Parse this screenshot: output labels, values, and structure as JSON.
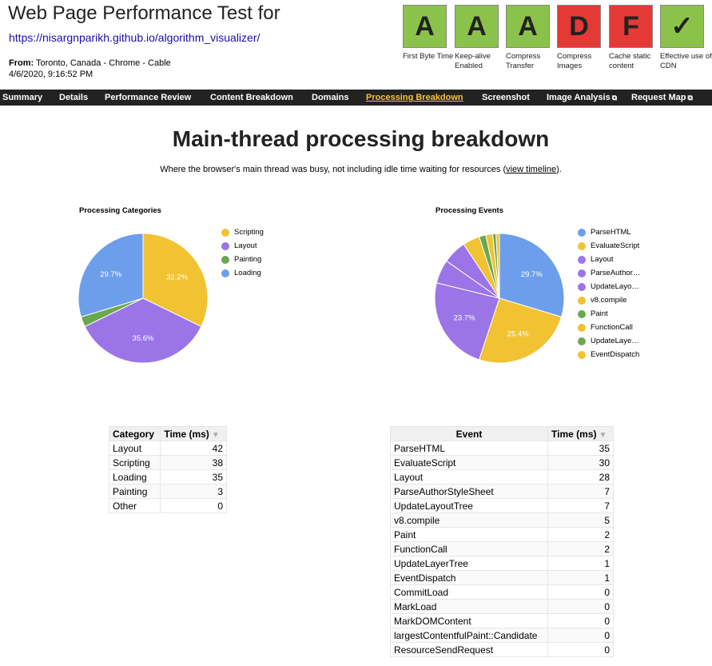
{
  "header": {
    "title": "Web Page Performance Test for",
    "url": "https://nisargnparikh.github.io/algorithm_visualizer/",
    "from_label": "From:",
    "from_value": "Toronto, Canada - Chrome - Cable",
    "date": "4/6/2020, 9:16:52 PM"
  },
  "grades": [
    {
      "grade": "A",
      "label": "First Byte Time",
      "color": "#8bc34a"
    },
    {
      "grade": "A",
      "label": "Keep-alive Enabled",
      "color": "#8bc34a"
    },
    {
      "grade": "A",
      "label": "Compress Transfer",
      "color": "#8bc34a"
    },
    {
      "grade": "D",
      "label": "Compress Images",
      "color": "#e53935"
    },
    {
      "grade": "F",
      "label": "Cache static content",
      "color": "#e53935"
    },
    {
      "grade": "✓",
      "label": "Effective use of CDN",
      "color": "#8bc34a"
    }
  ],
  "nav": {
    "items": [
      "Summary",
      "Details",
      "Performance Review",
      "Content Breakdown",
      "Domains",
      "Processing Breakdown",
      "Screenshot",
      "Image Analysis",
      "Request Map"
    ],
    "active": "Processing Breakdown",
    "external_icon": "external-link-icon"
  },
  "main": {
    "heading": "Main-thread processing breakdown",
    "subtitle_pre": "Where the browser's main thread was busy, not including idle time waiting for resources (",
    "subtitle_link": "view timeline",
    "subtitle_post": ")."
  },
  "chart_data": [
    {
      "type": "pie",
      "title": "Processing Categories",
      "legend_position": "right",
      "slices": [
        {
          "label": "Scripting",
          "value": 38,
          "color": "#f1c232",
          "percent_label": "32.2%"
        },
        {
          "label": "Layout",
          "value": 42,
          "color": "#9b74e8",
          "percent_label": "35.6%"
        },
        {
          "label": "Painting",
          "value": 3,
          "color": "#6aa84f",
          "percent_label": ""
        },
        {
          "label": "Loading",
          "value": 35,
          "color": "#6d9eeb",
          "percent_label": "29.7%"
        }
      ]
    },
    {
      "type": "pie",
      "title": "Processing Events",
      "legend_position": "right",
      "slices": [
        {
          "label": "ParseHTML",
          "value": 35,
          "color": "#6d9eeb",
          "percent_label": "29.7%"
        },
        {
          "label": "EvaluateScript",
          "value": 30,
          "color": "#f1c232",
          "percent_label": "25.4%"
        },
        {
          "label": "Layout",
          "value": 28,
          "color": "#9b74e8",
          "percent_label": "23.7%"
        },
        {
          "label": "ParseAuthor…",
          "value": 7,
          "color": "#9b74e8",
          "percent_label": ""
        },
        {
          "label": "UpdateLayo…",
          "value": 7,
          "color": "#9b74e8",
          "percent_label": ""
        },
        {
          "label": "v8.compile",
          "value": 5,
          "color": "#f1c232",
          "percent_label": ""
        },
        {
          "label": "Paint",
          "value": 2,
          "color": "#6aa84f",
          "percent_label": ""
        },
        {
          "label": "FunctionCall",
          "value": 2,
          "color": "#f1c232",
          "percent_label": ""
        },
        {
          "label": "UpdateLaye…",
          "value": 1,
          "color": "#6aa84f",
          "percent_label": ""
        },
        {
          "label": "EventDispatch",
          "value": 1,
          "color": "#f1c232",
          "percent_label": ""
        }
      ]
    }
  ],
  "category_table": {
    "headers": [
      "Category",
      "Time (ms)"
    ],
    "sort_icon": "sort-desc-icon",
    "rows": [
      [
        "Layout",
        "42"
      ],
      [
        "Scripting",
        "38"
      ],
      [
        "Loading",
        "35"
      ],
      [
        "Painting",
        "3"
      ],
      [
        "Other",
        "0"
      ]
    ]
  },
  "event_table": {
    "headers": [
      "Event",
      "Time (ms)"
    ],
    "sort_icon": "sort-desc-icon",
    "rows": [
      [
        "ParseHTML",
        "35"
      ],
      [
        "EvaluateScript",
        "30"
      ],
      [
        "Layout",
        "28"
      ],
      [
        "ParseAuthorStyleSheet",
        "7"
      ],
      [
        "UpdateLayoutTree",
        "7"
      ],
      [
        "v8.compile",
        "5"
      ],
      [
        "Paint",
        "2"
      ],
      [
        "FunctionCall",
        "2"
      ],
      [
        "UpdateLayerTree",
        "1"
      ],
      [
        "EventDispatch",
        "1"
      ],
      [
        "CommitLoad",
        "0"
      ],
      [
        "MarkLoad",
        "0"
      ],
      [
        "MarkDOMContent",
        "0"
      ],
      [
        "largestContentfulPaint::Candidate",
        "0"
      ],
      [
        "ResourceSendRequest",
        "0"
      ]
    ]
  }
}
